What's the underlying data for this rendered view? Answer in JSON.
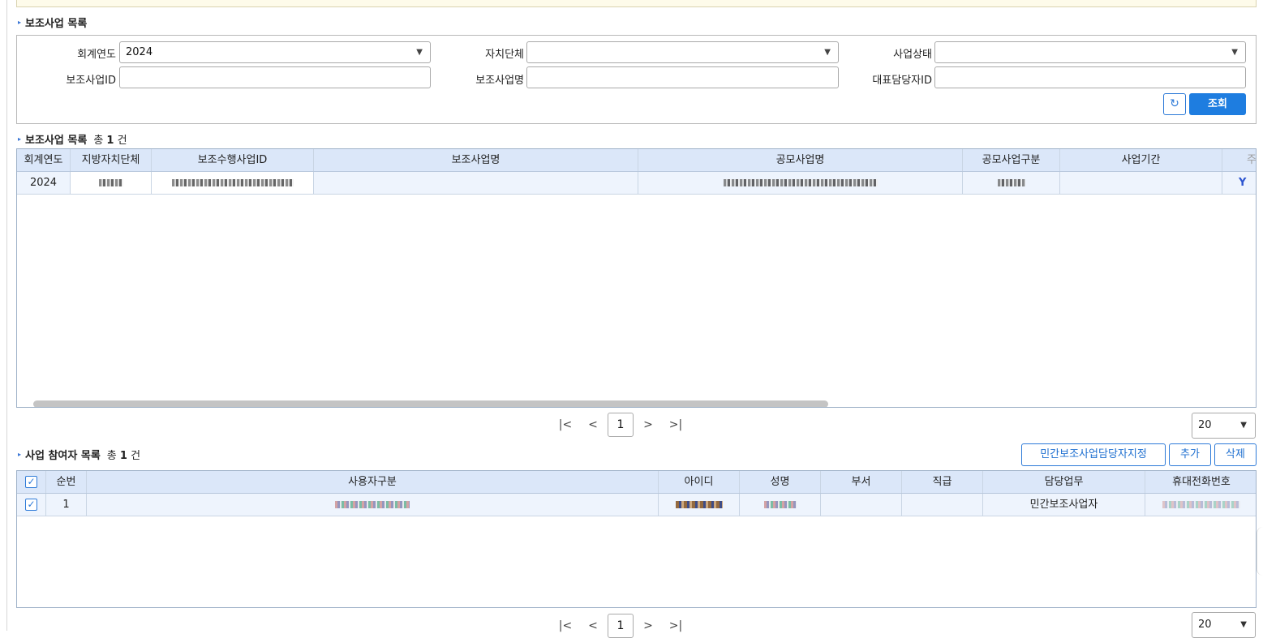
{
  "section_list": {
    "title": "보조사업 목록"
  },
  "search": {
    "fiscal_year_label": "회계연도",
    "fiscal_year_value": "2024",
    "local_gov_label": "자치단체",
    "local_gov_value": "",
    "status_label": "사업상태",
    "status_value": "",
    "project_id_label": "보조사업ID",
    "project_id_value": "",
    "project_name_label": "보조사업명",
    "project_name_value": "",
    "manager_id_label": "대표담당자ID",
    "manager_id_value": "",
    "refresh_icon": "refresh-icon",
    "search_label": "조회"
  },
  "grid1": {
    "title": "보조사업 목록",
    "count_prefix": "총",
    "count": "1",
    "count_suffix": "건",
    "columns": [
      "회계연도",
      "지방자치단체",
      "보조수행사업ID",
      "보조사업명",
      "공모사업명",
      "공모사업구분",
      "사업기간",
      "주"
    ],
    "rows": [
      {
        "year": "2024",
        "flag": "Y"
      }
    ]
  },
  "pager1": {
    "first": "|<",
    "prev": "<",
    "page": "1",
    "next": ">",
    "last": ">|",
    "page_size": "20"
  },
  "grid2": {
    "title": "사업 참여자 목록",
    "count_prefix": "총",
    "count": "1",
    "count_suffix": "건",
    "btn_assign": "민간보조사업담당자지정",
    "btn_add": "추가",
    "btn_delete": "삭제",
    "columns": [
      "순번",
      "사용자구분",
      "아이디",
      "성명",
      "부서",
      "직급",
      "담당업무",
      "휴대전화번호"
    ],
    "rows": [
      {
        "seq": "1",
        "duty": "민간보조사업자"
      }
    ]
  },
  "pager2": {
    "first": "|<",
    "prev": "<",
    "page": "1",
    "next": ">",
    "last": ">|",
    "page_size": "20"
  },
  "colors": {
    "accent": "#1e7de0",
    "header_bg": "#dbe7f9",
    "row_bg": "#eef4fd"
  }
}
